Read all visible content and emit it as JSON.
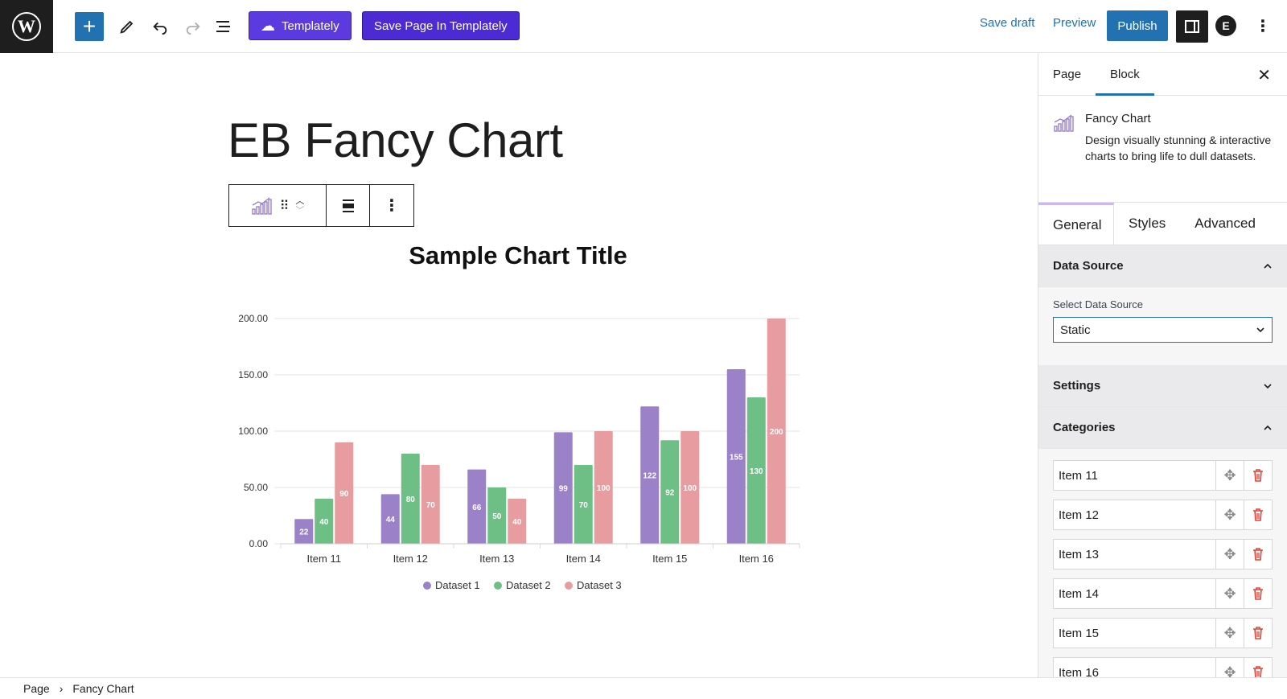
{
  "toolbar": {
    "templately_label": "Templately",
    "save_templately_label": "Save Page In Templately",
    "save_draft_label": "Save draft",
    "preview_label": "Preview",
    "publish_label": "Publish",
    "accent": "#2271b1",
    "templately_color": "#5b3ae0"
  },
  "editor": {
    "page_title": "EB Fancy Chart"
  },
  "chart_data": {
    "type": "bar",
    "title": "Sample Chart Title",
    "categories": [
      "Item 11",
      "Item 12",
      "Item 13",
      "Item 14",
      "Item 15",
      "Item 16"
    ],
    "series": [
      {
        "name": "Dataset 1",
        "color": "#9b82c8",
        "values": [
          22,
          44,
          66,
          99,
          122,
          155
        ]
      },
      {
        "name": "Dataset 2",
        "color": "#6dbf86",
        "values": [
          40,
          80,
          50,
          70,
          92,
          130
        ]
      },
      {
        "name": "Dataset 3",
        "color": "#e79da0",
        "values": [
          90,
          70,
          40,
          100,
          100,
          200
        ]
      }
    ],
    "y_ticks": [
      "0.00",
      "50.00",
      "100.00",
      "150.00",
      "200.00"
    ],
    "ylim": [
      0,
      200
    ],
    "grid": true,
    "legend": "bottom"
  },
  "breadcrumb": {
    "root": "Page",
    "current": "Fancy Chart"
  },
  "sidebar": {
    "tabs": [
      "Page",
      "Block"
    ],
    "active_tab": "Block",
    "block": {
      "name": "Fancy Chart",
      "description": "Design visually stunning & interactive charts to bring life to dull datasets."
    },
    "inspector_tabs": [
      "General",
      "Styles",
      "Advanced"
    ],
    "data_source": {
      "title": "Data Source",
      "select_label": "Select Data Source",
      "select_value": "Static"
    },
    "settings": {
      "title": "Settings"
    },
    "categories": {
      "title": "Categories",
      "items": [
        "Item 11",
        "Item 12",
        "Item 13",
        "Item 14",
        "Item 15",
        "Item 16"
      ]
    }
  }
}
